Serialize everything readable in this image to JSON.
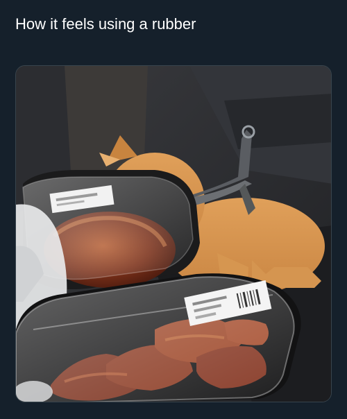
{
  "tweet": {
    "caption": "How it feels using a rubber"
  },
  "media": {
    "description_icon": "photo-dog-car-food",
    "label_text": "",
    "colors": {
      "background": "#15202b",
      "text": "#ffffff",
      "media_border": "#38444d"
    }
  }
}
